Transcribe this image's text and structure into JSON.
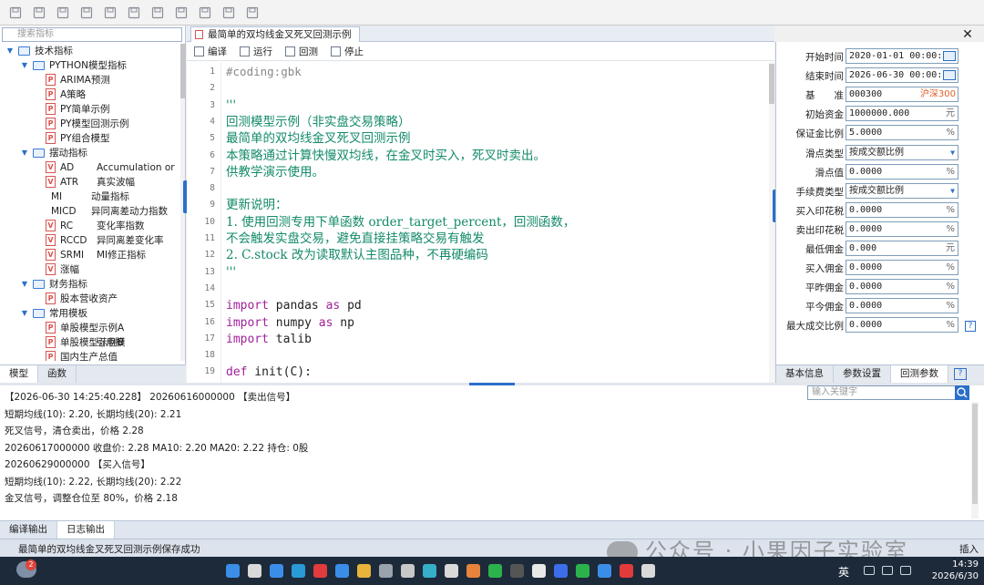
{
  "toolbar": {
    "icons": [
      "save-icon",
      "save-all-icon",
      "font-decrease-icon",
      "font-increase-icon",
      "import-icon",
      "export-icon",
      "edit-icon",
      "document-icon",
      "document-icon",
      "document-icon",
      "lock-icon"
    ]
  },
  "left_panel": {
    "search_placeholder": "搜索指标",
    "tree": [
      {
        "level": 0,
        "type": "folder",
        "expanded": true,
        "label": "技术指标",
        "label2": ""
      },
      {
        "level": 1,
        "type": "folder",
        "expanded": true,
        "label": "PYTHON模型指标",
        "label2": ""
      },
      {
        "level": 2,
        "type": "p",
        "label": "ARIMA预测",
        "label2": ""
      },
      {
        "level": 2,
        "type": "p",
        "label": "A策略",
        "label2": ""
      },
      {
        "level": 2,
        "type": "p",
        "label": "PY简单示例",
        "label2": ""
      },
      {
        "level": 2,
        "type": "p",
        "label": "PY模型回测示例",
        "label2": ""
      },
      {
        "level": 2,
        "type": "p",
        "label": "PY组合模型",
        "label2": ""
      },
      {
        "level": 1,
        "type": "folder",
        "expanded": true,
        "label": "摆动指标",
        "label2": ""
      },
      {
        "level": 2,
        "type": "v",
        "label": "AD",
        "label2": "Accumulation or"
      },
      {
        "level": 2,
        "type": "v",
        "label": "ATR",
        "label2": "真实波幅"
      },
      {
        "level": 2,
        "type": "none",
        "label": "MI",
        "label2": "动量指标"
      },
      {
        "level": 2,
        "type": "none",
        "label": "MICD",
        "label2": "异同离差动力指数"
      },
      {
        "level": 2,
        "type": "v",
        "label": "RC",
        "label2": "变化率指数"
      },
      {
        "level": 2,
        "type": "v",
        "label": "RCCD",
        "label2": "异同离差变化率"
      },
      {
        "level": 2,
        "type": "v",
        "label": "SRMI",
        "label2": "MI修正指标"
      },
      {
        "level": 2,
        "type": "av",
        "label": "涨幅",
        "label2": ""
      },
      {
        "level": 1,
        "type": "folder",
        "expanded": true,
        "label": "财务指标",
        "label2": ""
      },
      {
        "level": 2,
        "type": "p",
        "label": "股本营收资产",
        "label2": ""
      },
      {
        "level": 1,
        "type": "folder",
        "expanded": true,
        "label": "常用模板",
        "label2": ""
      },
      {
        "level": 2,
        "type": "p",
        "label": "单股模型示例A",
        "label2": ""
      },
      {
        "level": 2,
        "type": "p",
        "label": "单股模型示例B",
        "label2": "引用模"
      },
      {
        "level": 2,
        "type": "p",
        "label": "国内生产总值",
        "label2": ""
      }
    ],
    "tabs": [
      "模型",
      "函数"
    ]
  },
  "editor": {
    "tab_title": "最简单的双均线金叉死叉回测示例",
    "tools": [
      "编译",
      "运行",
      "回测",
      "停止"
    ],
    "lines": [
      {
        "n": "1",
        "cls": "c-comment",
        "text": "#coding:gbk"
      },
      {
        "n": "2",
        "cls": "c-str",
        "text": ""
      },
      {
        "n": "3",
        "cls": "c-str",
        "text": "'''"
      },
      {
        "n": "4",
        "cls": "c-str",
        "text": "回测模型示例（非实盘交易策略）"
      },
      {
        "n": "5",
        "cls": "c-str",
        "text": "最简单的双均线金叉死叉回测示例"
      },
      {
        "n": "6",
        "cls": "c-str",
        "text": "本策略通过计算快慢双均线，在金叉时买入，死叉时卖出。"
      },
      {
        "n": "7",
        "cls": "c-str",
        "text": "供教学演示使用。"
      },
      {
        "n": "8",
        "cls": "c-str",
        "text": ""
      },
      {
        "n": "9",
        "cls": "c-str",
        "text": "更新说明："
      },
      {
        "n": "10",
        "cls": "c-str",
        "text": "1. 使用回测专用下单函数 order_target_percent，回测函数，"
      },
      {
        "n": "11",
        "cls": "c-str",
        "text": "不会触发实盘交易，避免直接挂策略交易有触发"
      },
      {
        "n": "12",
        "cls": "c-str",
        "text": "2. C.stock 改为读取默认主图品种，不再硬编码"
      },
      {
        "n": "13",
        "cls": "c-str",
        "text": "'''"
      },
      {
        "n": "14",
        "cls": "c-id",
        "text": ""
      },
      {
        "n": "15",
        "cls": "mix",
        "kw": "import",
        "mid": " pandas ",
        "kw2": "as",
        "end": " pd"
      },
      {
        "n": "16",
        "cls": "mix",
        "kw": "import",
        "mid": " numpy ",
        "kw2": "as",
        "end": " np"
      },
      {
        "n": "17",
        "cls": "mix",
        "kw": "import",
        "mid": " talib",
        "kw2": "",
        "end": ""
      },
      {
        "n": "18",
        "cls": "c-id",
        "text": ""
      },
      {
        "n": "19",
        "cls": "mix",
        "kw": "def",
        "mid": " init(C):",
        "kw2": "",
        "end": ""
      }
    ]
  },
  "right_panel": {
    "params": [
      {
        "label": "开始时间",
        "value": "2020-01-01 00:00:00",
        "suffix": "cal"
      },
      {
        "label": "结束时间",
        "value": "2026-06-30 00:00:00",
        "suffix": "cal"
      },
      {
        "label": "基　　准",
        "value": "000300",
        "suffix": "red",
        "extra": "沪深300"
      },
      {
        "label": "初始资金",
        "value": "1000000.000",
        "suffix": "unit",
        "extra": "元"
      },
      {
        "label": "保证金比例",
        "value": "5.0000",
        "suffix": "unit",
        "extra": "%"
      },
      {
        "label": "滑点类型",
        "value": "按成交额比例",
        "suffix": "drop"
      },
      {
        "label": "滑点值",
        "value": "0.0000",
        "suffix": "unit",
        "extra": "%"
      },
      {
        "label": "手续费类型",
        "value": "按成交额比例",
        "suffix": "drop"
      },
      {
        "label": "买入印花税",
        "value": "0.0000",
        "suffix": "unit",
        "extra": "%"
      },
      {
        "label": "卖出印花税",
        "value": "0.0000",
        "suffix": "unit",
        "extra": "%"
      },
      {
        "label": "最低佣金",
        "value": "0.000",
        "suffix": "unit",
        "extra": "元"
      },
      {
        "label": "买入佣金",
        "value": "0.0000",
        "suffix": "unit",
        "extra": "%"
      },
      {
        "label": "平昨佣金",
        "value": "0.0000",
        "suffix": "unit",
        "extra": "%"
      },
      {
        "label": "平今佣金",
        "value": "0.0000",
        "suffix": "unit",
        "extra": "%"
      },
      {
        "label": "最大成交比例",
        "value": "0.0000",
        "suffix": "unit",
        "extra": "%"
      }
    ],
    "tabs": [
      "基本信息",
      "参数设置",
      "回测参数"
    ],
    "help": "?"
  },
  "output": {
    "search_placeholder": "输入关键字",
    "lines": [
      "【2026-06-30 14:25:40.228】  20260616000000 【卖出信号】",
      "短期均线(10): 2.20, 长期均线(20): 2.21",
      "死叉信号，清仓卖出，价格 2.28",
      "20260617000000  收盘价: 2.28  MA10: 2.20  MA20: 2.22  持仓: 0股",
      "20260629000000 【买入信号】",
      "短期均线(10): 2.22, 长期均线(20): 2.22",
      "金叉信号，调整仓位至 80%，价格 2.18"
    ],
    "tabs": [
      "编译输出",
      "日志输出"
    ]
  },
  "status": {
    "message": "最简单的双均线金叉死叉回测示例保存成功",
    "mode": "插入"
  },
  "watermark": "公众号 · 小果因子实验室",
  "taskbar": {
    "badge": "2",
    "lang": "英",
    "time": "14:39",
    "date": "2026/6/30"
  }
}
